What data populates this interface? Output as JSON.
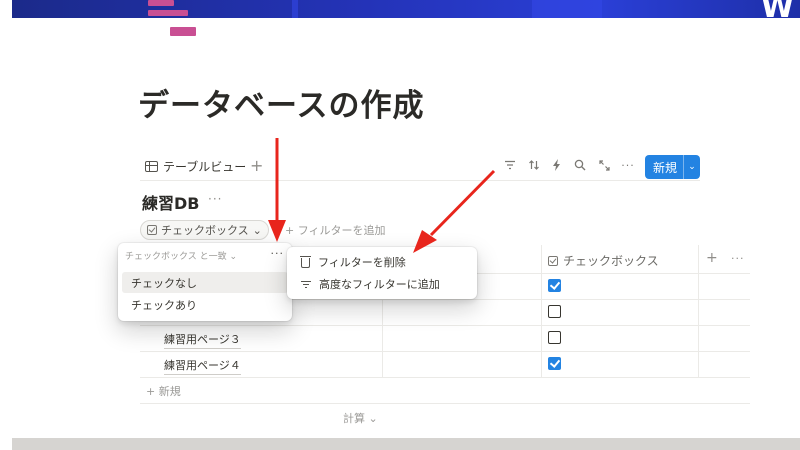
{
  "page": {
    "title": "データベースの作成"
  },
  "view": {
    "tab_label": "テーブルビュー",
    "add_view": "+",
    "new_button": "新規",
    "new_chevron": "⌄"
  },
  "database": {
    "title": "練習DB",
    "more": "···"
  },
  "filter": {
    "chip_label": "チェックボックス",
    "chip_chevron": "⌄",
    "add_filter": "+ フィルターを追加"
  },
  "table": {
    "column_header": "チェックボックス",
    "header_add": "+",
    "header_more": "···",
    "rows": [
      {
        "name": "",
        "checked": true
      },
      {
        "name": "",
        "checked": false
      },
      {
        "name": "練習用ページ３",
        "checked": false
      },
      {
        "name": "練習用ページ４",
        "checked": true
      }
    ],
    "new_row": "+ 新規",
    "calculate": "計算 ⌄"
  },
  "filter_popup": {
    "header": "チェックボックス と一致 ⌄",
    "more": "···",
    "options": [
      {
        "label": "チェックなし",
        "selected": true
      },
      {
        "label": "チェックあり",
        "selected": false
      }
    ]
  },
  "context_menu": {
    "items": [
      {
        "label": "フィルターを削除",
        "icon": "trash-icon"
      },
      {
        "label": "高度なフィルターに追加",
        "icon": "filter-icon"
      }
    ]
  },
  "colors": {
    "accent_blue": "#2383e2",
    "annotation_red": "#e8251c",
    "page_icon_pink": "#c94f93",
    "cover_blue": "#2433b8"
  }
}
